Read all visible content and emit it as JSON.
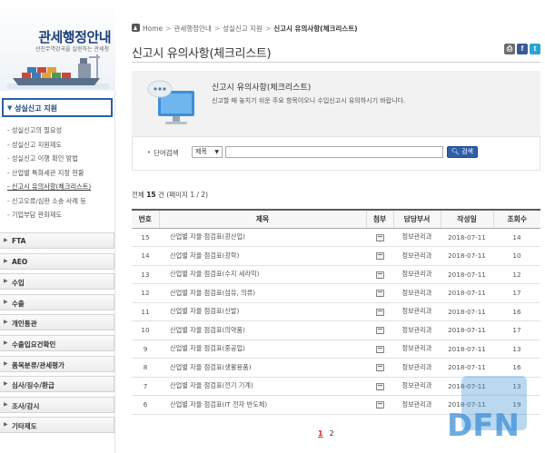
{
  "brand": {
    "title": "관세행정안내",
    "subtitle": "선진무역강국을 실현하는 관세청"
  },
  "sidebar": {
    "active_section": "성실신고 지원",
    "sub_items": [
      "성실신고의 필요성",
      "성실신고 지원제도",
      "성실신고 이행 확인 방법",
      "산업별 특화세관 지정 현황",
      "신고시 유의사항(체크리스트)",
      "신고오류/심판 소송 사례 등",
      "기업부담 완화제도"
    ],
    "current_sub": 4,
    "menu": [
      "FTA",
      "AEO",
      "수입",
      "수출",
      "개인통관",
      "수출입요건확인",
      "품목분류/관세평가",
      "심사/징수/환급",
      "조사/감시",
      "기타제도"
    ]
  },
  "breadcrumb": {
    "items": [
      "Home",
      "관세행정안내",
      "성실신고 지원",
      "신고시 유의사항(체크리스트)"
    ]
  },
  "page": {
    "title": "신고시 유의사항(체크리스트)"
  },
  "share": {
    "print": "⎙",
    "facebook": "f",
    "twitter": "t"
  },
  "intro": {
    "title": "신고시 유의사항(체크리스트)",
    "desc": "신고할 때 놓치기 쉬운 주요 항목이오니 수입신고시 유의하시기 바랍니다."
  },
  "search": {
    "label": "단어검색",
    "select_value": "제목",
    "input_value": "",
    "button_label": "검색"
  },
  "count": {
    "prefix": "전체",
    "total": "15",
    "suffix": "건 (페이지 1 / 2)"
  },
  "table": {
    "headers": [
      "번호",
      "제목",
      "첨부",
      "담당부서",
      "작성일",
      "조회수"
    ],
    "rows": [
      {
        "no": "15",
        "title": "산업별 자율 점검표(광산업)",
        "dept": "정보관리과",
        "date": "2018-07-11",
        "views": "14"
      },
      {
        "no": "14",
        "title": "산업별 자율 점검표(광학)",
        "dept": "정보관리과",
        "date": "2018-07-11",
        "views": "10"
      },
      {
        "no": "13",
        "title": "산업별 자율 점검표(수지 세라믹)",
        "dept": "정보관리과",
        "date": "2018-07-11",
        "views": "12"
      },
      {
        "no": "12",
        "title": "산업별 자율 점검표(섬유, 의류)",
        "dept": "정보관리과",
        "date": "2018-07-11",
        "views": "17"
      },
      {
        "no": "11",
        "title": "산업별 자율 점검표(신발)",
        "dept": "정보관리과",
        "date": "2018-07-11",
        "views": "16"
      },
      {
        "no": "10",
        "title": "산업별 자율 점검표(의약품)",
        "dept": "정보관리과",
        "date": "2018-07-11",
        "views": "17"
      },
      {
        "no": "9",
        "title": "산업별 자율 점검표(중공업)",
        "dept": "정보관리과",
        "date": "2018-07-11",
        "views": "13"
      },
      {
        "no": "8",
        "title": "산업별 자율 점검표(생활용품)",
        "dept": "정보관리과",
        "date": "2018-07-11",
        "views": "16"
      },
      {
        "no": "7",
        "title": "산업별 자율 점검표(전기 기계)",
        "dept": "정보관리과",
        "date": "2018-07-11",
        "views": "13"
      },
      {
        "no": "6",
        "title": "산업별 자율 점검표(IT 전자 반도체)",
        "dept": "정보관리과",
        "date": "2018-07-11",
        "views": "19"
      }
    ]
  },
  "pager": {
    "pages": [
      "1",
      "2"
    ],
    "current": "1"
  },
  "watermark": {
    "text": "DFN"
  },
  "colors": {
    "brand_blue": "#1d3f7a",
    "accent_blue": "#2c5fa8",
    "facebook": "#3b5998",
    "twitter": "#2aa3d6",
    "pager_active": "#dd2222"
  }
}
